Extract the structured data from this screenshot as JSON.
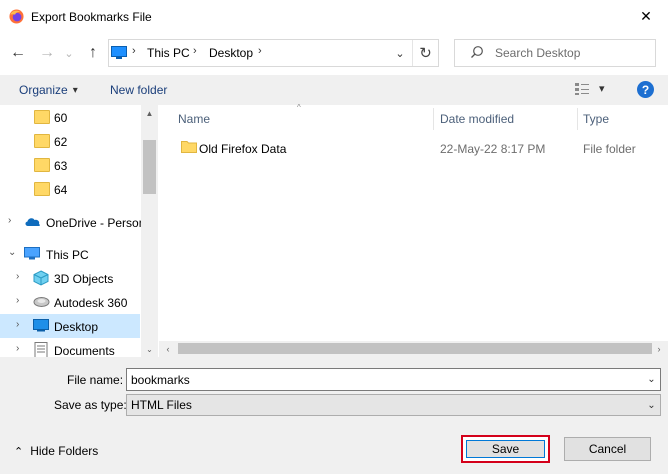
{
  "window": {
    "title": "Export Bookmarks File",
    "close_glyph": "✕",
    "app_icon": "firefox-icon"
  },
  "nav": {
    "back_glyph": "←",
    "forward_glyph": "→",
    "history_glyph": "⌄",
    "up_glyph": "↑",
    "breadcrumb": [
      "This PC",
      "Desktop"
    ],
    "chevron_glyph": "›",
    "refresh_glyph": "↻",
    "dropdown_glyph": "⌄",
    "search_placeholder": "Search Desktop"
  },
  "toolbar": {
    "organize_label": "Organize",
    "organize_caret": "▾",
    "new_folder_label": "New folder",
    "view_caret": "▾",
    "help_label": "?"
  },
  "tree": {
    "items": [
      {
        "label": "60",
        "icon": "folder-icon"
      },
      {
        "label": "62",
        "icon": "folder-icon"
      },
      {
        "label": "63",
        "icon": "folder-icon"
      },
      {
        "label": "64",
        "icon": "folder-icon"
      },
      {
        "label": "OneDrive - Person",
        "icon": "onedrive-icon",
        "chevron": "›"
      },
      {
        "label": "This PC",
        "icon": "this-pc-icon",
        "chevron": "⌄"
      },
      {
        "label": "3D Objects",
        "icon": "3d-objects-icon",
        "chevron": "›"
      },
      {
        "label": "Autodesk 360",
        "icon": "autodesk-icon",
        "chevron": "›"
      },
      {
        "label": "Desktop",
        "icon": "desktop-icon",
        "chevron": "›",
        "selected": true
      },
      {
        "label": "Documents",
        "icon": "documents-icon",
        "chevron": "›"
      }
    ]
  },
  "files": {
    "columns": [
      "Name",
      "Date modified",
      "Type"
    ],
    "sort_glyph": "^",
    "rows": [
      {
        "name": "Old Firefox Data",
        "date": "22-May-22 8:17 PM",
        "type": "File folder"
      }
    ]
  },
  "form": {
    "filename_label": "File name:",
    "filename_value": "bookmarks",
    "savetype_label": "Save as type:",
    "savetype_value": "HTML Files",
    "dropdown_glyph": "⌄"
  },
  "footer": {
    "hide_folders_label": "Hide Folders",
    "hide_folders_glyph": "⌃",
    "save_label": "Save",
    "cancel_label": "Cancel"
  },
  "colors": {
    "accent": "#0078d7",
    "highlight": "#d4001a",
    "selected_bg": "#cce8ff"
  }
}
